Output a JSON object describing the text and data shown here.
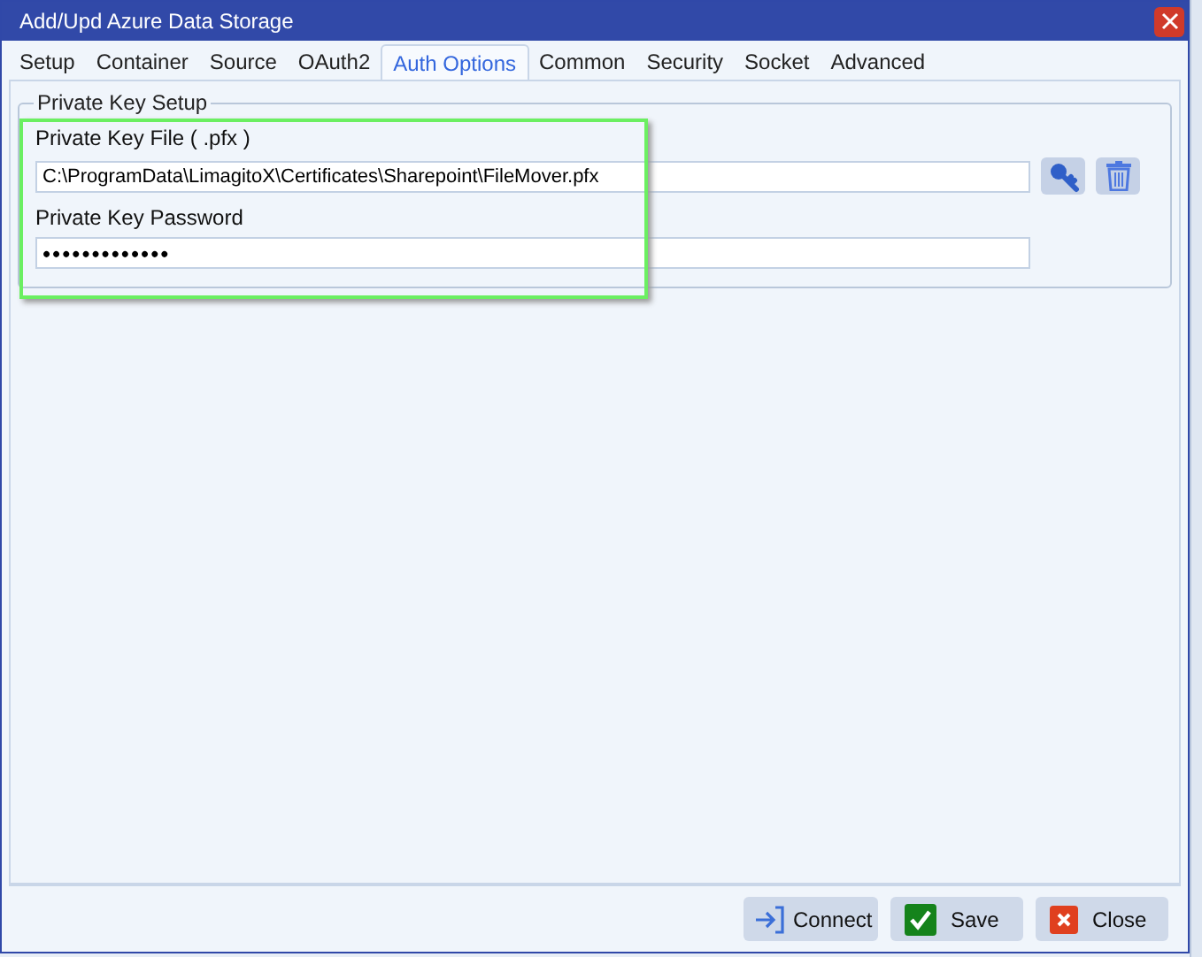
{
  "window": {
    "title": "Add/Upd Azure Data Storage"
  },
  "tabs": [
    {
      "label": "Setup",
      "selected": false
    },
    {
      "label": "Container",
      "selected": false
    },
    {
      "label": "Source",
      "selected": false
    },
    {
      "label": "OAuth2",
      "selected": false
    },
    {
      "label": "Auth Options",
      "selected": true
    },
    {
      "label": "Common",
      "selected": false
    },
    {
      "label": "Security",
      "selected": false
    },
    {
      "label": "Socket",
      "selected": false
    },
    {
      "label": "Advanced",
      "selected": false
    }
  ],
  "group": {
    "title": "Private Key Setup",
    "file_label": "Private Key File ( .pfx )",
    "file_value": "C:\\ProgramData\\LimagitoX\\Certificates\\Sharepoint\\FileMover.pfx",
    "password_label": "Private Key Password",
    "password_value": "•••••••••••••"
  },
  "buttons": [
    {
      "label": "Connect",
      "kind": "connect"
    },
    {
      "label": "Save",
      "kind": "save"
    },
    {
      "label": "Close",
      "kind": "close"
    }
  ]
}
